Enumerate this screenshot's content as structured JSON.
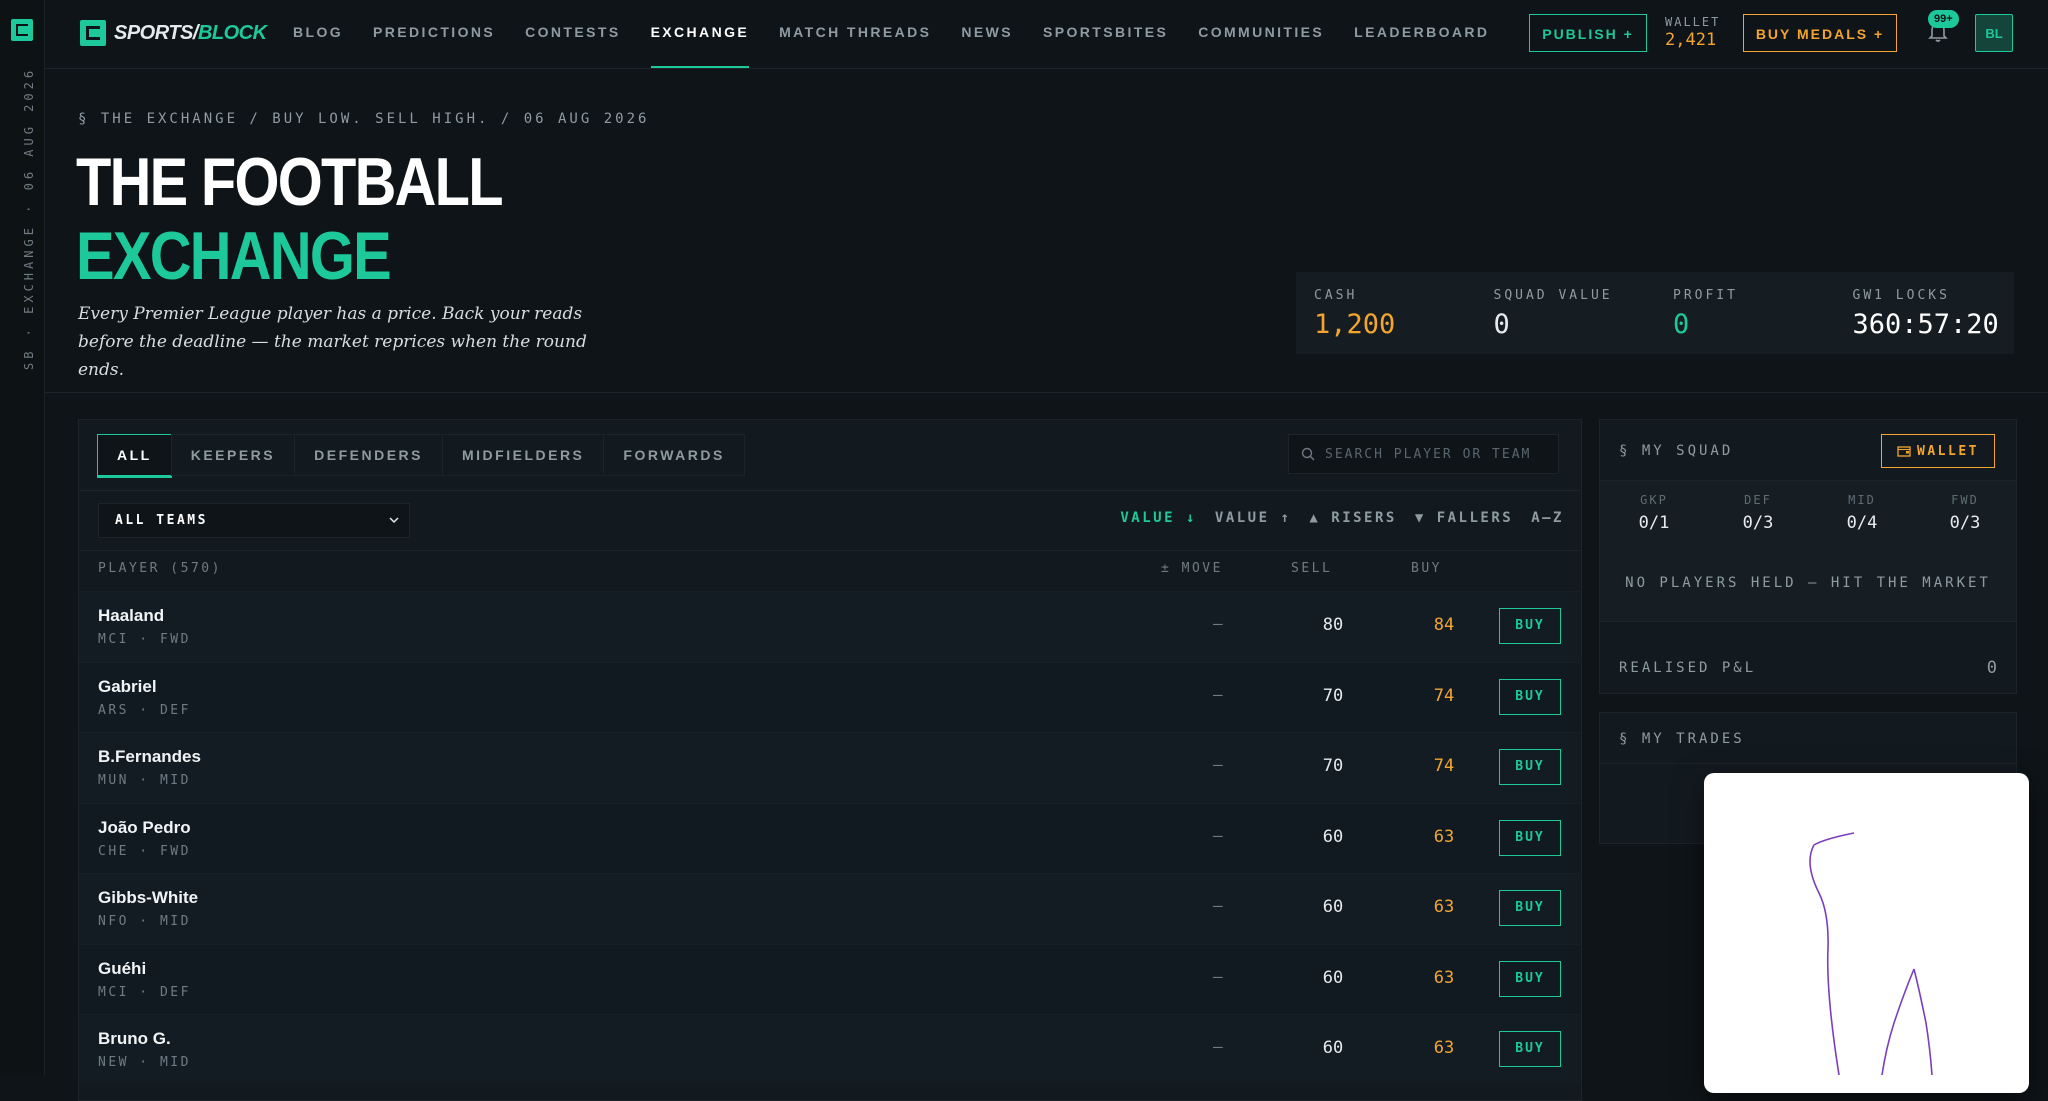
{
  "rail": {
    "text": "SB · EXCHANGE · 06 AUG 2026"
  },
  "brand": {
    "part1": "SPORTS/",
    "part2": "BLOCK"
  },
  "nav": {
    "items": [
      {
        "label": "BLOG"
      },
      {
        "label": "PREDICTIONS"
      },
      {
        "label": "CONTESTS"
      },
      {
        "label": "EXCHANGE"
      },
      {
        "label": "MATCH THREADS"
      },
      {
        "label": "NEWS"
      },
      {
        "label": "SPORTSBITES"
      },
      {
        "label": "COMMUNITIES"
      },
      {
        "label": "LEADERBOARD"
      }
    ],
    "active": "EXCHANGE"
  },
  "header": {
    "publish_label": "PUBLISH +",
    "wallet_label": "WALLET",
    "wallet_value": "2,421",
    "medals_label": "BUY MEDALS +",
    "notif_badge": "99+",
    "avatar_initials": "BL"
  },
  "hero": {
    "crumb": "§ THE EXCHANGE / BUY LOW. SELL HIGH. / 06 AUG 2026",
    "title_line1": "THE FOOTBALL",
    "title_line2": "EXCHANGE",
    "subtitle": "Every Premier League player has a price. Back your reads before the deadline — the market reprices when the round ends.",
    "stats": [
      {
        "label": "CASH",
        "value": "1,200",
        "color": "#f3a530"
      },
      {
        "label": "SQUAD VALUE",
        "value": "0",
        "color": "#e6eaed"
      },
      {
        "label": "PROFIT",
        "value": "0",
        "color": "#1dc99a"
      },
      {
        "label": "GW1 LOCKS",
        "value": "360:57:20",
        "color": "#ffffff"
      }
    ]
  },
  "market": {
    "tabs": [
      "ALL",
      "KEEPERS",
      "DEFENDERS",
      "MIDFIELDERS",
      "FORWARDS"
    ],
    "active_tab": "ALL",
    "search_placeholder": "SEARCH PLAYER OR TEAM",
    "team_filter": "ALL TEAMS",
    "sorts": [
      {
        "label": "VALUE ↓",
        "active": true
      },
      {
        "label": "VALUE ↑",
        "active": false
      },
      {
        "label": "▲ RISERS",
        "active": false
      },
      {
        "label": "▼ FALLERS",
        "active": false
      },
      {
        "label": "A–Z",
        "active": false
      }
    ],
    "columns": {
      "player": "PLAYER (570)",
      "move": "± MOVE",
      "sell": "SELL",
      "buy": "BUY"
    },
    "buy_label": "BUY",
    "players": [
      {
        "name": "Haaland",
        "meta": "MCI · FWD",
        "move": "—",
        "sell": "80",
        "buy": "84"
      },
      {
        "name": "Gabriel",
        "meta": "ARS · DEF",
        "move": "—",
        "sell": "70",
        "buy": "74"
      },
      {
        "name": "B.Fernandes",
        "meta": "MUN · MID",
        "move": "—",
        "sell": "70",
        "buy": "74"
      },
      {
        "name": "João Pedro",
        "meta": "CHE · FWD",
        "move": "—",
        "sell": "60",
        "buy": "63"
      },
      {
        "name": "Gibbs-White",
        "meta": "NFO · MID",
        "move": "—",
        "sell": "60",
        "buy": "63"
      },
      {
        "name": "Guéhi",
        "meta": "MCI · DEF",
        "move": "—",
        "sell": "60",
        "buy": "63"
      },
      {
        "name": "Bruno G.",
        "meta": "NEW · MID",
        "move": "—",
        "sell": "60",
        "buy": "63"
      }
    ]
  },
  "squad": {
    "title": "§ MY SQUAD",
    "wallet_btn": "WALLET",
    "positions": [
      {
        "label": "GKP",
        "value": "0/1"
      },
      {
        "label": "DEF",
        "value": "0/3"
      },
      {
        "label": "MID",
        "value": "0/4"
      },
      {
        "label": "FWD",
        "value": "0/3"
      }
    ],
    "empty_message": "NO PLAYERS HELD — HIT THE MARKET",
    "pnl_label": "REALISED P&L",
    "pnl_value": "0"
  },
  "trades": {
    "title": "§ MY TRADES"
  }
}
